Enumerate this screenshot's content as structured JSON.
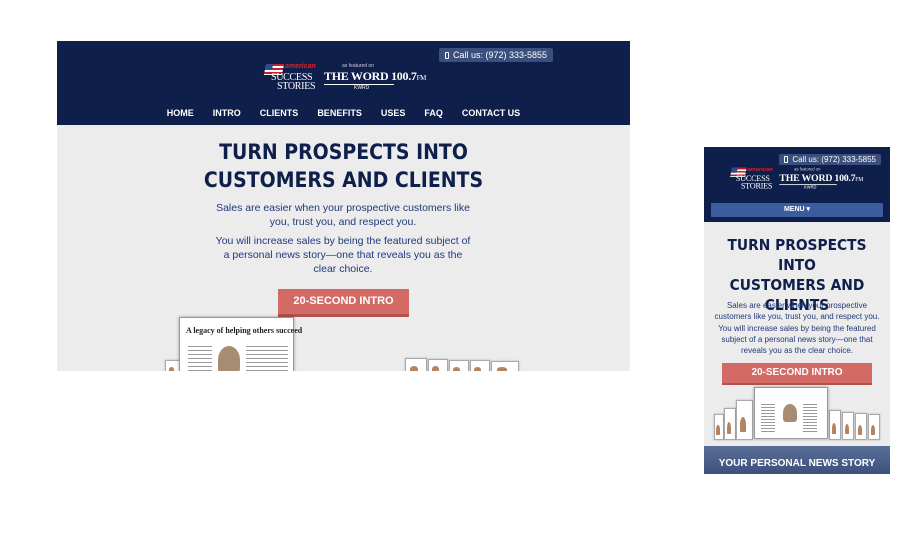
{
  "desktop": {
    "call": "Call us: (972) 333-5855",
    "logo_ss": {
      "american": "american",
      "line1": "SUCCESS",
      "line2": "STORIES"
    },
    "logo_word": {
      "featured": "as featured on",
      "main": "THE WORD 100.7",
      "fm": "FM",
      "call_sign": "KWRD"
    },
    "nav": [
      "HOME",
      "INTRO",
      "CLIENTS",
      "BENEFITS",
      "USES",
      "FAQ",
      "CONTACT US"
    ],
    "title_line1": "TURN PROSPECTS INTO",
    "title_line2": "CUSTOMERS AND CLIENTS",
    "para1": "Sales are easier when your prospective customers like you, trust you, and respect you.",
    "para2": "You will increase sales by being the featured subject of a personal news story—one that reveals you as the clear choice.",
    "button": "20-SECOND INTRO",
    "paper_headline": "A legacy of helping others succeed"
  },
  "mobile": {
    "call": "Call us: (972) 333-5855",
    "menu": "MENU ▾",
    "title_line1": "TURN PROSPECTS INTO",
    "title_line2": "CUSTOMERS AND",
    "title_line3": "CLIENTS",
    "para1": "Sales are easier when your prospective customers like you, trust you, and respect you.",
    "para2": "You will increase sales by being the featured subject of a personal news story—one that reveals you as the clear choice.",
    "button": "20-SECOND INTRO",
    "footer": "YOUR PERSONAL NEWS STORY"
  },
  "colors": {
    "navy": "#0f1f4b",
    "button": "#d36a66",
    "text_blue": "#1f3a7a",
    "background": "#ececec"
  }
}
